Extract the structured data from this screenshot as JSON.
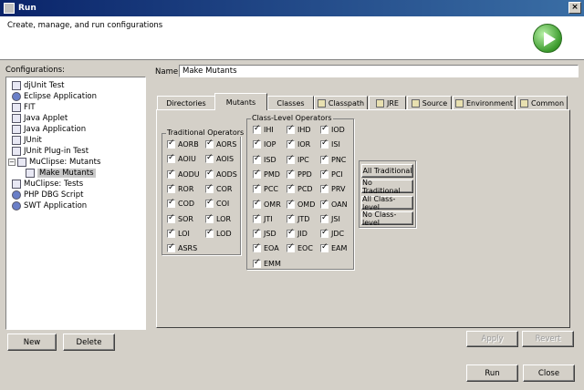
{
  "window": {
    "title": "Run",
    "close": "×"
  },
  "header": {
    "description": "Create, manage, and run configurations"
  },
  "configurations": {
    "label": "Configurations:",
    "items": [
      {
        "label": "djUnit Test",
        "level": 0,
        "icon": "junit-icon"
      },
      {
        "label": "Eclipse Application",
        "level": 0,
        "icon": "eclipse-icon"
      },
      {
        "label": "FIT",
        "level": 0,
        "icon": "fit-icon"
      },
      {
        "label": "Java Applet",
        "level": 0,
        "icon": "applet-icon"
      },
      {
        "label": "Java Application",
        "level": 0,
        "icon": "java-app-icon"
      },
      {
        "label": "JUnit",
        "level": 0,
        "icon": "junit-icon"
      },
      {
        "label": "JUnit Plug-in Test",
        "level": 0,
        "icon": "junit-plugin-icon"
      },
      {
        "label": "MuClipse: Mutants",
        "level": 0,
        "icon": "muclipse-icon",
        "expanded": true
      },
      {
        "label": "Make Mutants",
        "level": 1,
        "icon": "mutant-icon",
        "selected": true
      },
      {
        "label": "MuClipse: Tests",
        "level": 0,
        "icon": "muclipse-test-icon"
      },
      {
        "label": "PHP DBG Script",
        "level": 0,
        "icon": "php-icon"
      },
      {
        "label": "SWT Application",
        "level": 0,
        "icon": "swt-icon"
      }
    ],
    "new_label": "New",
    "delete_label": "Delete"
  },
  "name": {
    "label": "Name:",
    "value": "Make Mutants"
  },
  "tabs": [
    {
      "label": "Directories",
      "active": false
    },
    {
      "label": "Mutants",
      "active": true
    },
    {
      "label": "Classes",
      "active": false
    },
    {
      "label": "Classpath",
      "active": false,
      "icon": "classpath-icon"
    },
    {
      "label": "JRE",
      "active": false,
      "icon": "jre-icon"
    },
    {
      "label": "Source",
      "active": false,
      "icon": "source-icon"
    },
    {
      "label": "Environment",
      "active": false,
      "icon": "environment-icon"
    },
    {
      "label": "Common",
      "active": false,
      "icon": "common-icon"
    }
  ],
  "traditional": {
    "title": "Traditional Operators",
    "operators": [
      "AORB",
      "AORS",
      "AOIU",
      "AOIS",
      "AODU",
      "AODS",
      "ROR",
      "COR",
      "COD",
      "COI",
      "SOR",
      "LOR",
      "LOI",
      "LOD",
      "ASRS"
    ]
  },
  "class_level": {
    "title": "Class-Level Operators",
    "operators": [
      "IHI",
      "IHD",
      "IOD",
      "IOP",
      "IOR",
      "ISI",
      "ISD",
      "IPC",
      "PNC",
      "PMD",
      "PPD",
      "PCI",
      "PCC",
      "PCD",
      "PRV",
      "OMR",
      "OMD",
      "OAN",
      "JTI",
      "JTD",
      "JSI",
      "JSD",
      "JID",
      "JDC",
      "EOA",
      "EOC",
      "EAM",
      "EMM"
    ]
  },
  "select_buttons": {
    "all_traditional": "All Traditional",
    "no_traditional": "No Traditional",
    "all_class_level": "All Class-level",
    "no_class_level": "No Class-level"
  },
  "actions": {
    "apply": "Apply",
    "revert": "Revert",
    "run": "Run",
    "close": "Close"
  }
}
